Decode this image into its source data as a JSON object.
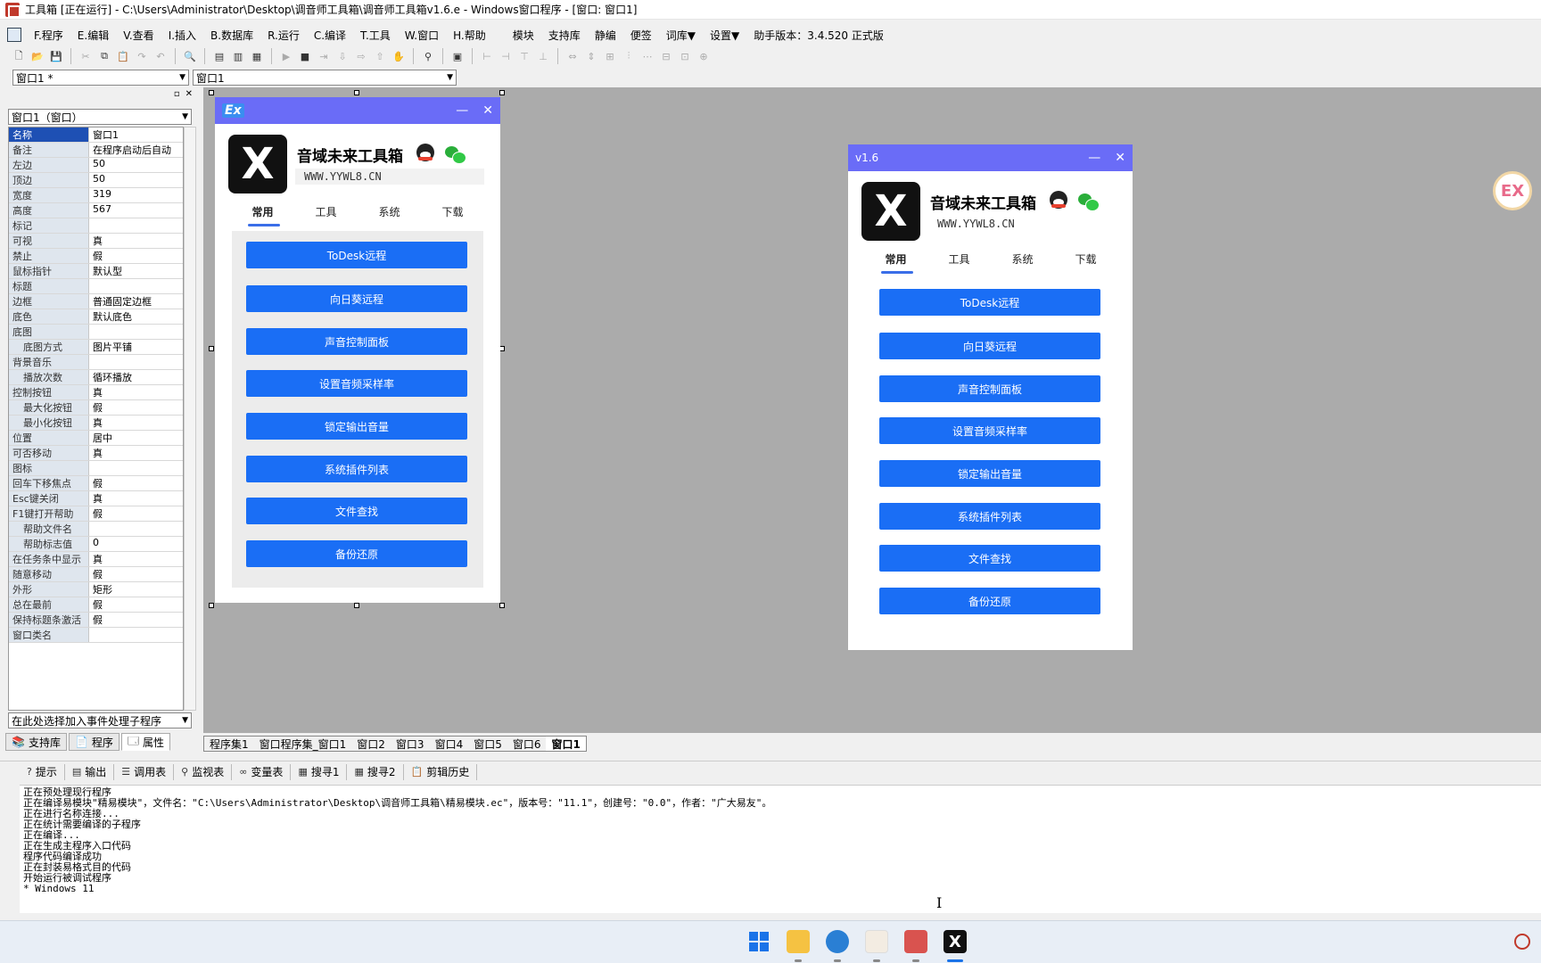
{
  "window": {
    "title": "工具箱 [正在运行] - C:\\Users\\Administrator\\Desktop\\调音师工具箱\\调音师工具箱v1.6.e - Windows窗口程序 - [窗口: 窗口1]"
  },
  "menu": {
    "items": [
      "F.程序",
      "E.编辑",
      "V.查看",
      "I.插入",
      "B.数据库",
      "R.运行",
      "C.编译",
      "T.工具",
      "W.窗口",
      "H.帮助",
      "模块",
      "支持库",
      "静编",
      "便签",
      "词库▼",
      "设置▼",
      "助手版本：3.4.520 正式版"
    ]
  },
  "combos": {
    "window_combo": "窗口1 *",
    "object_combo": "窗口1"
  },
  "properties": {
    "object_combo": "窗口1（窗口）",
    "rows": [
      {
        "k": "名称",
        "v": "窗口1",
        "sel": true
      },
      {
        "k": "备注",
        "v": "在程序启动后自动"
      },
      {
        "k": "左边",
        "v": "50"
      },
      {
        "k": "顶边",
        "v": "50"
      },
      {
        "k": "宽度",
        "v": "319"
      },
      {
        "k": "高度",
        "v": "567"
      },
      {
        "k": "标记",
        "v": ""
      },
      {
        "k": "可视",
        "v": "真"
      },
      {
        "k": "禁止",
        "v": "假"
      },
      {
        "k": "鼠标指针",
        "v": "默认型"
      },
      {
        "k": "标题",
        "v": ""
      },
      {
        "k": "边框",
        "v": "普通固定边框"
      },
      {
        "k": "底色",
        "v": "默认底色"
      },
      {
        "k": "底图",
        "v": ""
      },
      {
        "k": "底图方式",
        "v": "图片平铺",
        "indent": true
      },
      {
        "k": "背景音乐",
        "v": ""
      },
      {
        "k": "播放次数",
        "v": "循环播放",
        "indent": true
      },
      {
        "k": "控制按钮",
        "v": "真"
      },
      {
        "k": "最大化按钮",
        "v": "假",
        "indent": true
      },
      {
        "k": "最小化按钮",
        "v": "真",
        "indent": true
      },
      {
        "k": "位置",
        "v": "居中"
      },
      {
        "k": "可否移动",
        "v": "真"
      },
      {
        "k": "图标",
        "v": ""
      },
      {
        "k": "回车下移焦点",
        "v": "假"
      },
      {
        "k": "Esc键关闭",
        "v": "真"
      },
      {
        "k": "F1键打开帮助",
        "v": "假"
      },
      {
        "k": "帮助文件名",
        "v": "",
        "indent": true
      },
      {
        "k": "帮助标志值",
        "v": "0",
        "indent": true
      },
      {
        "k": "在任务条中显示",
        "v": "真"
      },
      {
        "k": "随意移动",
        "v": "假"
      },
      {
        "k": "外形",
        "v": "矩形"
      },
      {
        "k": "总在最前",
        "v": "假"
      },
      {
        "k": "保持标题条激活",
        "v": "假"
      },
      {
        "k": "窗口类名",
        "v": ""
      }
    ],
    "event_combo": "在此处选择加入事件处理子程序",
    "tabs": [
      "支持库",
      "程序",
      "属性"
    ]
  },
  "toolwin": {
    "version": "v1.6",
    "ex_label": "Ex",
    "min_icon": "—",
    "close_icon": "✕",
    "brand_name": "音域未来工具箱",
    "url": "WWW.YYWL8.CN",
    "logo_glyph": "X",
    "tabs": [
      "常用",
      "工具",
      "系统",
      "下载"
    ],
    "buttons": [
      "ToDesk远程",
      "向日葵远程",
      "声音控制面板",
      "设置音频采样率",
      "锁定输出音量",
      "系统插件列表",
      "文件查找",
      "备份还原"
    ]
  },
  "ex_badge": "EX",
  "code_tabs": [
    "程序集1",
    "窗口程序集_窗口1",
    "窗口2",
    "窗口3",
    "窗口4",
    "窗口5",
    "窗口6",
    "窗口1"
  ],
  "output": {
    "tabs": [
      "提示",
      "输出",
      "调用表",
      "监视表",
      "变量表",
      "搜寻1",
      "搜寻2",
      "剪辑历史"
    ],
    "lines": [
      "正在预处理现行程序",
      "正在编译易模块\"精易模块\"，文件名：\"C:\\Users\\Administrator\\Desktop\\调音师工具箱\\精易模块.ec\"，版本号：\"11.1\"，创建号：\"0.0\"，作者：\"广大易友\"。",
      "正在进行名称连接...",
      "正在统计需要编译的子程序",
      "正在编译...",
      "正在生成主程序入口代码",
      "程序代码编译成功",
      "正在封装易格式目的代码",
      "开始运行被调试程序",
      "* Windows 11"
    ]
  },
  "colors": {
    "title_bar": "#6a6cf7",
    "button_blue": "#1a6ef5",
    "design_bg": "#ababab"
  }
}
